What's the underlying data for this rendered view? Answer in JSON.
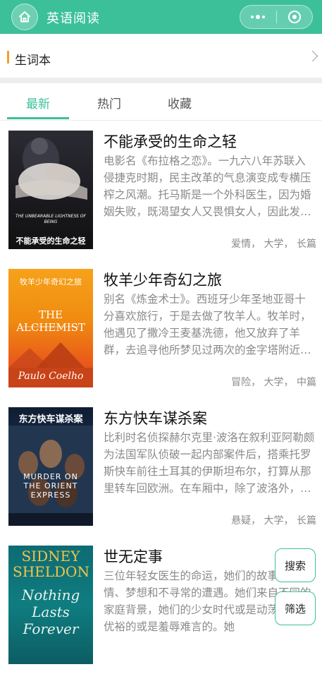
{
  "header": {
    "title": "英语阅读",
    "home_icon": "home-icon",
    "more_icon": "more-dots-icon",
    "close_icon": "target-icon",
    "bg_color": "#3cc09a"
  },
  "vocab": {
    "label": "生词本",
    "accent": "#f0a02a"
  },
  "tabs": [
    {
      "label": "最新",
      "active": true
    },
    {
      "label": "热门",
      "active": false
    },
    {
      "label": "收藏",
      "active": false
    }
  ],
  "books": [
    {
      "title": "不能承受的生命之轻",
      "description": "电影名《布拉格之恋》。一九六八年苏联入侵捷克时期，民主改革的气息演变成专横压榨之风潮。托马斯是一个外科医生，因为婚姻失败，既渴望女人又畏惧女人，因此发展出一套外遇守则来...",
      "tags": "爱情， 大学， 长篇",
      "cover_title": "不能承受的生命之轻",
      "cover_en": "THE UNBEARABLE LIGHTNESS OF BEING"
    },
    {
      "title": "牧羊少年奇幻之旅",
      "description": "别名《炼金术士》。西班牙少年圣地亚哥十分喜欢旅行，于是去做了牧羊人。牧羊时，他遇见了撒冷王麦基洗德，他又放弃了羊群，去追寻他所梦见过两次的金字塔附近的宝藏。其间，他从西...",
      "tags": "冒险， 大学， 中篇",
      "cover_title": "牧羊少年奇幻之旅",
      "cover_en": "THE ALCHEMIST",
      "cover_author": "Paulo Coelho"
    },
    {
      "title": "东方快车谋杀案",
      "description": "比利时名侦探赫尔克里·波洛在叙利亚阿勒颇为法国军队侦破一起内部案件后，搭乘托罗斯快车前往土耳其的伊斯坦布尔，打算从那里转车回欧洲。在车厢中，除了波洛外，只有两位英国旅...",
      "tags": "悬疑， 大学， 长篇",
      "cover_title": "东方快车谋杀案",
      "cover_en": "MURDER ON THE ORIENT EXPRESS"
    },
    {
      "title": "世无定事",
      "description": "三位年轻女医生的命运，她们的故事充满爱情、梦想和不寻常的遭遇。她们来自不同的家庭背景，她们的少女时代或是动荡的或是优裕的或是羞辱难言的。她",
      "tags": "",
      "cover_author": "SIDNEY SHELDON",
      "cover_en": "Nothing Lasts Forever"
    }
  ],
  "floating": {
    "search_label": "搜索",
    "filter_label": "筛选"
  }
}
